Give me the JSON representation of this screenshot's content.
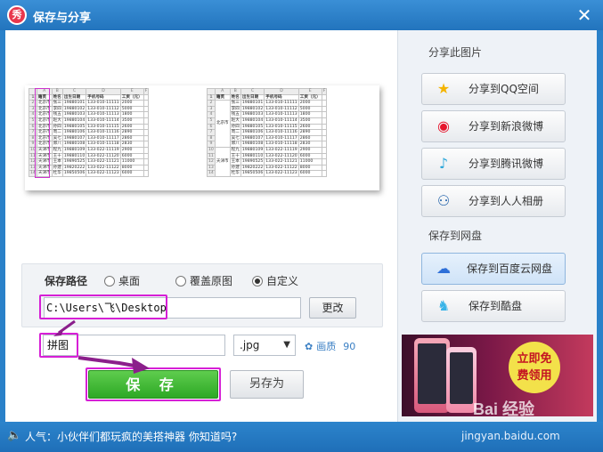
{
  "window": {
    "title": "保存与分享",
    "logo_text": "秀",
    "close_symbol": "✕"
  },
  "preview": {
    "col_letters_left": [
      "",
      "A",
      "B",
      "C",
      "D",
      "E",
      "F"
    ],
    "headers_left": [
      "籍贯",
      "姓名",
      "出生日期",
      "手机号码",
      "工资（元）"
    ],
    "rows_left": [
      [
        "北京市",
        "张三",
        "19880101",
        "133-010-11111",
        "2000"
      ],
      [
        "北京市",
        "李四",
        "19880102",
        "133-010-11112",
        "5000"
      ],
      [
        "北京市",
        "钱五",
        "19880103",
        "133-010-11113",
        "1800"
      ],
      [
        "北京市",
        "赵大",
        "19880104",
        "133-010-11114",
        "3500"
      ],
      [
        "北京市",
        "孙四",
        "19880105",
        "133-010-11115",
        "2600"
      ],
      [
        "北京市",
        "周二",
        "19880106",
        "133-010-11116",
        "2890"
      ],
      [
        "北京市",
        "吴七",
        "19880107",
        "133-010-11117",
        "2860"
      ],
      [
        "北京市",
        "郑八",
        "19880108",
        "133-010-11118",
        "2830"
      ],
      [
        "天津市",
        "程九",
        "19880109",
        "133-022-11119",
        "2900"
      ],
      [
        "天津市",
        "王十",
        "19880110",
        "133-022-11120",
        "6000"
      ],
      [
        "天津市",
        "王本",
        "19890525",
        "133-022-11121",
        "11000"
      ],
      [
        "天津市",
        "孙建",
        "19820222",
        "133-022-11122",
        "8000"
      ],
      [
        "天津市",
        "杜华",
        "19850506",
        "133-022-11123",
        "6000"
      ]
    ],
    "col_letters_right": [
      "",
      "A",
      "B",
      "C",
      "D",
      "E",
      "F"
    ],
    "headers_right": [
      "籍贯",
      "姓名",
      "出生日期",
      "手机号码",
      "工资（元）"
    ],
    "group_right": [
      "北京市",
      "天津市"
    ],
    "rows_right": [
      [
        "张三",
        "19880101",
        "133-010-11111",
        "2000"
      ],
      [
        "李四",
        "19880102",
        "133-010-11112",
        "5000"
      ],
      [
        "钱五",
        "19880103",
        "133-010-11113",
        "1800"
      ],
      [
        "赵大",
        "19880104",
        "133-010-11114",
        "3500"
      ],
      [
        "孙四",
        "19880105",
        "133-010-11115",
        "2600"
      ],
      [
        "周二",
        "19880106",
        "133-010-11116",
        "2890"
      ],
      [
        "吴七",
        "19880107",
        "133-010-11117",
        "2860"
      ],
      [
        "郑八",
        "19880108",
        "133-010-11118",
        "2830"
      ],
      [
        "程九",
        "19880109",
        "133-022-11119",
        "2900"
      ],
      [
        "王十",
        "19880110",
        "133-022-11120",
        "6000"
      ],
      [
        "王本",
        "19890525",
        "133-022-11121",
        "11000"
      ],
      [
        "孙建",
        "19820222",
        "133-022-11122",
        "8000"
      ],
      [
        "杜华",
        "19850506",
        "133-022-11123",
        "6000"
      ]
    ]
  },
  "save_path": {
    "label": "保存路径",
    "options": [
      "桌面",
      "覆盖原图",
      "自定义"
    ],
    "selected_index": 2,
    "path_value": "C:\\Users\\飞\\Desktop",
    "change_label": "更改"
  },
  "file": {
    "name_value": "拼图",
    "ext_value": ".jpg",
    "quality_label": "画质",
    "quality_value": "90"
  },
  "actions": {
    "save_label": "保 存",
    "save_as_label": "另存为"
  },
  "share": {
    "section_title": "分享此图片",
    "buttons": [
      {
        "label": "分享到QQ空间",
        "icon": "star-icon"
      },
      {
        "label": "分享到新浪微博",
        "icon": "weibo-icon"
      },
      {
        "label": "分享到腾讯微博",
        "icon": "tencent-weibo-icon"
      },
      {
        "label": "分享到人人相册",
        "icon": "renren-icon"
      }
    ]
  },
  "cloud": {
    "section_title": "保存到网盘",
    "buttons": [
      {
        "label": "保存到百度云网盘",
        "icon": "baidu-cloud-icon"
      },
      {
        "label": "保存到酷盘",
        "icon": "kupan-icon"
      }
    ]
  },
  "ad": {
    "promo_line1": "立即免",
    "promo_line2": "费领用",
    "watermark": "Bai 经验"
  },
  "status": {
    "message": "人气：小伙伴们都玩疯的美搭神器 你知道吗?",
    "site": "jingyan.baidu.com"
  },
  "colors": {
    "highlight": "#d61fd6",
    "save_green": "#2da825",
    "titlebar_blue": "#2274bd"
  }
}
